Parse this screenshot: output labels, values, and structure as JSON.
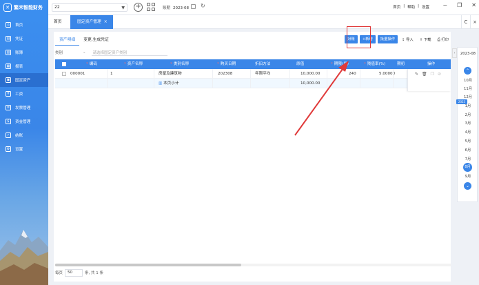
{
  "app": {
    "name": "繁禾智能财务"
  },
  "sidebar": {
    "items": [
      {
        "label": "首页",
        "icon": "home-icon"
      },
      {
        "label": "凭证",
        "icon": "voucher-icon"
      },
      {
        "label": "账簿",
        "icon": "book-icon"
      },
      {
        "label": "报表",
        "icon": "report-icon"
      },
      {
        "label": "固定资产",
        "icon": "asset-icon",
        "active": true
      },
      {
        "label": "工资",
        "icon": "salary-icon"
      },
      {
        "label": "发票管理",
        "icon": "invoice-icon"
      },
      {
        "label": "资金管理",
        "icon": "fund-icon"
      },
      {
        "label": "结账",
        "icon": "close-account-icon"
      },
      {
        "label": "设置",
        "icon": "settings-icon"
      }
    ]
  },
  "topbar": {
    "account_value": "22",
    "period_label": "账期",
    "period_value": "2023-08",
    "links": [
      "首页",
      "|",
      "帮助",
      "|",
      "设置"
    ]
  },
  "tabs": {
    "home": "首页",
    "active": "固定资产管理",
    "close": "×",
    "right": [
      "C",
      "×"
    ]
  },
  "subtabs": [
    "资产明细",
    "变更,生成凭证"
  ],
  "toolbar": {
    "buttons": [
      "对账",
      "+新增",
      "批量操作"
    ],
    "links": [
      "导入",
      "下载",
      "打印"
    ]
  },
  "filter": {
    "label": "类别",
    "placeholder": "请选择固定资产类别"
  },
  "table": {
    "headers": [
      "编码",
      "资产名称",
      "类别名称",
      "购买日期",
      "折旧方法",
      "原值",
      "期限(月)",
      "残值率(%)",
      "期初",
      "操作"
    ],
    "rows": [
      {
        "code": "000001",
        "name": "1",
        "category": "房屋及建筑物",
        "date": "202308",
        "method": "年限平均",
        "value": "10,000.00",
        "term": "240",
        "residual": "5.00000"
      }
    ],
    "subtotal": {
      "label": "本页小计",
      "value": "10,000.00"
    }
  },
  "pager": {
    "prefix": "每页",
    "size": "50",
    "suffix": "条, 共 1 条"
  },
  "period_panel": {
    "year": "2023-08",
    "badge": "2023",
    "months": [
      "10月",
      "11月",
      "12月",
      "1月",
      "2月",
      "3月",
      "4月",
      "5月",
      "6月",
      "7月",
      "8月",
      "9月"
    ],
    "selected": "8月"
  },
  "colors": {
    "accent": "#3a86e8",
    "highlight": "#e03a3a"
  }
}
